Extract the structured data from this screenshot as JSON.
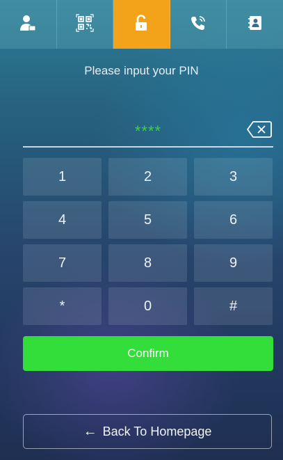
{
  "tabs": [
    {
      "icon": "user-key-icon",
      "active": false
    },
    {
      "icon": "qr-code-icon",
      "active": false
    },
    {
      "icon": "unlock-icon",
      "active": true
    },
    {
      "icon": "phone-call-icon",
      "active": false
    },
    {
      "icon": "contacts-icon",
      "active": false
    }
  ],
  "prompt": "Please input your PIN",
  "pin": {
    "value": "****"
  },
  "keypad": [
    "1",
    "2",
    "3",
    "4",
    "5",
    "6",
    "7",
    "8",
    "9",
    "*",
    "0",
    "#"
  ],
  "confirm_label": "Confirm",
  "back": {
    "arrow": "←",
    "label": "Back To Homepage"
  },
  "colors": {
    "accent": "#f3a31a",
    "confirm": "#33dd3a",
    "pin_text": "#3cd23f"
  }
}
